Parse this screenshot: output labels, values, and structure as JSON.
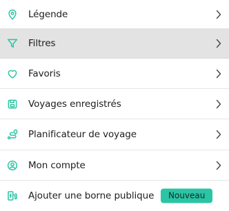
{
  "menu": {
    "accent_color": "#2bc4a4",
    "items": [
      {
        "label": "Légende",
        "icon": "map-pin-icon",
        "active": false,
        "has_chevron": true
      },
      {
        "label": "Filtres",
        "icon": "filter-icon",
        "active": true,
        "has_chevron": true
      },
      {
        "label": "Favoris",
        "icon": "heart-icon",
        "active": false,
        "has_chevron": true
      },
      {
        "label": "Voyages enregistrés",
        "icon": "save-icon",
        "active": false,
        "has_chevron": true
      },
      {
        "label": "Planificateur de voyage",
        "icon": "route-icon",
        "active": false,
        "has_chevron": true
      },
      {
        "label": "Mon compte",
        "icon": "account-icon",
        "active": false,
        "has_chevron": true
      },
      {
        "label": "Ajouter une borne publique",
        "icon": "charging-station-icon",
        "active": false,
        "has_chevron": false,
        "badge": "Nouveau"
      }
    ]
  }
}
